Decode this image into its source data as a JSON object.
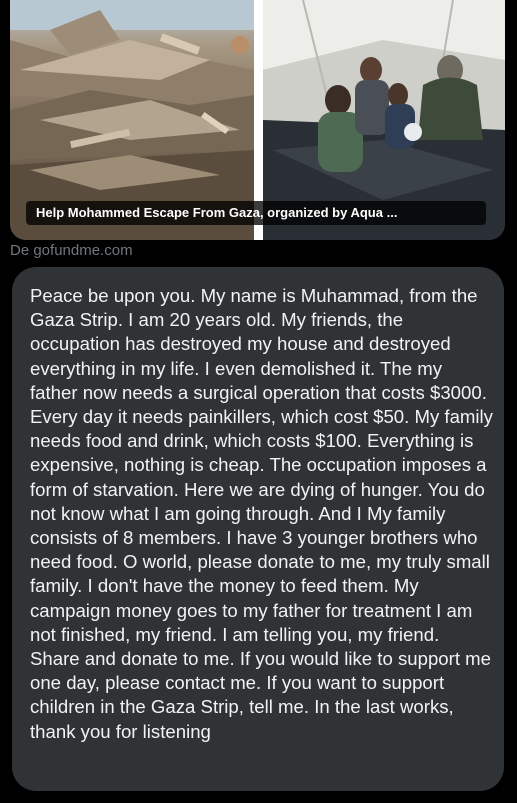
{
  "link_card": {
    "caption": "Help Mohammed Escape From Gaza, organized by Aqua ...",
    "source": "De gofundme.com",
    "images": [
      "rubble-photo",
      "family-in-tent-photo"
    ]
  },
  "message": {
    "text": "Peace be upon you. My name is Muhammad, from the Gaza Strip. I am 20 years old. My friends, the occupation has destroyed my house and destroyed everything in my life. I even demolished it. The my father  now needs a surgical operation that costs $3000. Every day it needs painkillers, which cost $50. My family needs food and drink, which costs $100. Everything is expensive, nothing is cheap. The occupation imposes a form of starvation. Here we are dying of hunger. You do not know what I am going through. And I My family consists of 8 members. I have 3 younger brothers who need food. O world, please donate to me, my truly small family. I don't have the money to feed them. My campaign money goes to my father for treatment I am not finished, my friend. I am telling you, my friend. Share and donate to me. If you would like to support me one day, please contact me. If you want to support children in the Gaza Strip, tell me. In the last works, thank you for listening"
  },
  "colors": {
    "background": "#000000",
    "bubble": "#2f3336",
    "source_text": "#71767b",
    "message_text": "#f2f2f2"
  }
}
